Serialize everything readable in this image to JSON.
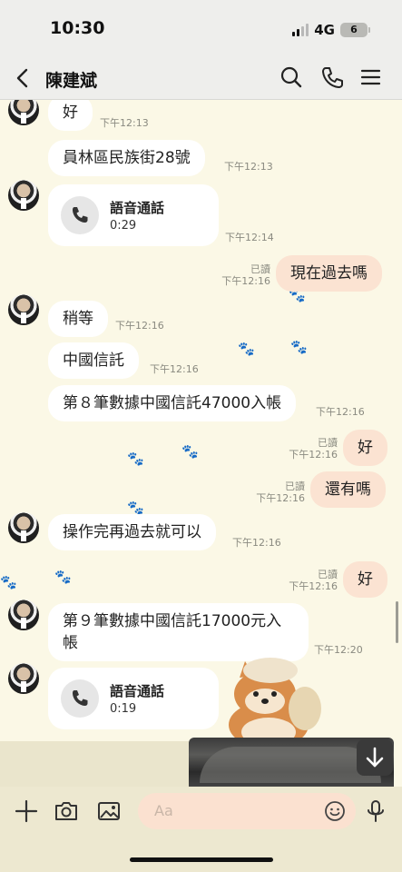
{
  "status_bar": {
    "time": "10:30",
    "network": "4G",
    "battery": "6"
  },
  "header": {
    "title": "陳建斌"
  },
  "messages": [
    {
      "text": "好",
      "time": "下午12:13"
    },
    {
      "text": "員林區民族街28號",
      "time": "下午12:13"
    },
    {
      "call_title": "語音通話",
      "call_duration": "0:29",
      "time": "下午12:14"
    },
    {
      "text": "現在過去嗎",
      "read": "已讀",
      "time": "下午12:16"
    },
    {
      "text": "稍等",
      "time": "下午12:16"
    },
    {
      "text": "中國信託",
      "time": "下午12:16"
    },
    {
      "text": "第８筆數據中國信託47000入帳",
      "time": "下午12:16"
    },
    {
      "text": "好",
      "read": "已讀",
      "time": "下午12:16"
    },
    {
      "text": "還有嗎",
      "read": "已讀",
      "time": "下午12:16"
    },
    {
      "text": "操作完再過去就可以",
      "time": "下午12:16"
    },
    {
      "text": "好",
      "read": "已讀",
      "time": "下午12:16"
    },
    {
      "text": "第９筆數據中國信託17000元入帳",
      "time": "下午12:20"
    },
    {
      "call_title": "語音通話",
      "call_duration": "0:19"
    }
  ],
  "composer": {
    "placeholder": "Aa"
  },
  "colors": {
    "background": "#fbf8e6",
    "outgoing_bubble": "#fbe3d2",
    "incoming_bubble": "#ffffff",
    "input": "#fbe1d0"
  },
  "icons": [
    "back-icon",
    "search-icon",
    "phone-icon",
    "menu-icon",
    "plus-icon",
    "camera-icon",
    "image-icon",
    "emoji-icon",
    "mic-icon",
    "arrow-down-icon"
  ]
}
